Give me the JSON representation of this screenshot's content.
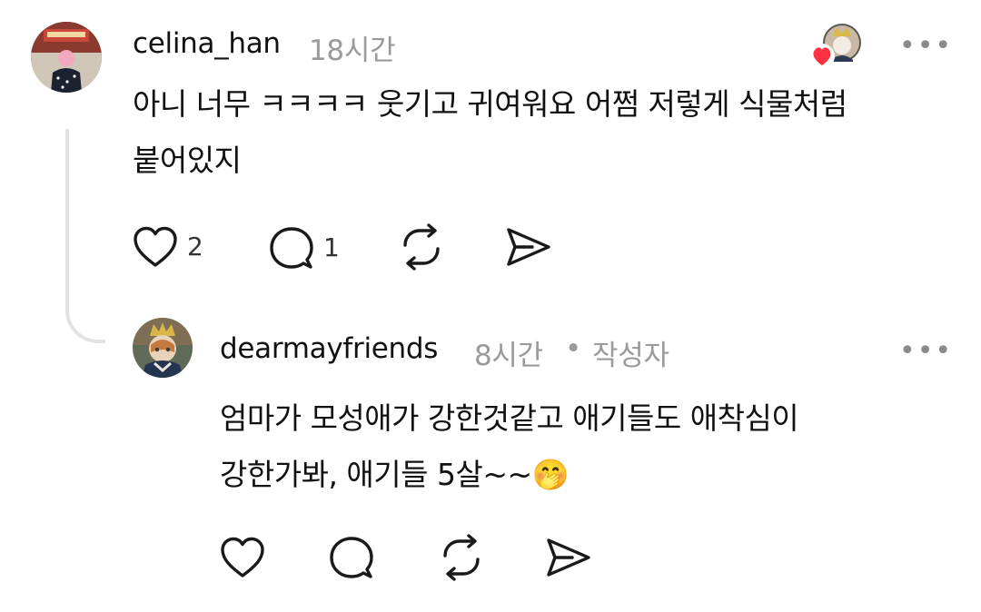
{
  "comment": {
    "username": "celina_han",
    "time": "18시간",
    "text_line1": "아니 너무 ㅋㅋㅋㅋ 웃기고 귀여워요 어쩜 저렇게 식물처럼",
    "text_line2": "붙어있지",
    "like_count": "2",
    "reply_count": "1",
    "more_label": "•••",
    "icons": [
      "heart-icon",
      "comment-icon",
      "repost-icon",
      "share-icon",
      "author-like-heart-icon"
    ]
  },
  "reply": {
    "username": "dearmayfriends",
    "time": "8시간",
    "separator": "•",
    "author_badge": "작성자",
    "text_line1": "엄마가 모성애가 강한것같고 애기들도 애착심이",
    "text_line2": "강한가봐, 애기들 5살~~🤭",
    "more_label": "•••",
    "icons": [
      "heart-icon",
      "comment-icon",
      "repost-icon",
      "share-icon"
    ]
  },
  "colors": {
    "text": "#111111",
    "muted": "#9a9a9a",
    "thread_line": "#e3e3e3",
    "heart_red": "#ff3040"
  }
}
